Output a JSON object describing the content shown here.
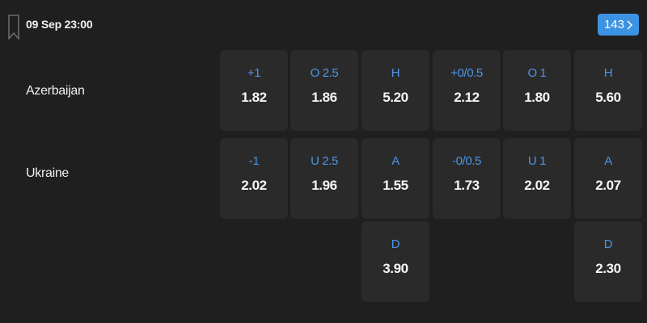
{
  "match": {
    "datetime": "09 Sep 23:00",
    "markets_count": "143",
    "home_team": "Azerbaijan",
    "away_team": "Ukraine"
  },
  "colors": {
    "background": "#1f1f1f",
    "cell": "#2a2a2a",
    "label_blue": "#4b95e6",
    "badge_blue": "#3d93e3"
  },
  "icons": {
    "bookmark": "bookmark-icon",
    "chevron": "chevron-right-icon"
  },
  "odds": {
    "home": [
      {
        "label": "+1",
        "odd": "1.82"
      },
      {
        "label": "O 2.5",
        "odd": "1.86"
      },
      {
        "label": "H",
        "odd": "5.20"
      },
      {
        "label": "+0/0.5",
        "odd": "2.12"
      },
      {
        "label": "O 1",
        "odd": "1.80"
      },
      {
        "label": "H",
        "odd": "5.60"
      }
    ],
    "away": [
      {
        "label": "-1",
        "odd": "2.02"
      },
      {
        "label": "U 2.5",
        "odd": "1.96"
      },
      {
        "label": "A",
        "odd": "1.55"
      },
      {
        "label": "-0/0.5",
        "odd": "1.73"
      },
      {
        "label": "U 1",
        "odd": "2.02"
      },
      {
        "label": "A",
        "odd": "2.07"
      }
    ],
    "draw": {
      "col3": {
        "label": "D",
        "odd": "3.90"
      },
      "col6": {
        "label": "D",
        "odd": "2.30"
      }
    }
  }
}
